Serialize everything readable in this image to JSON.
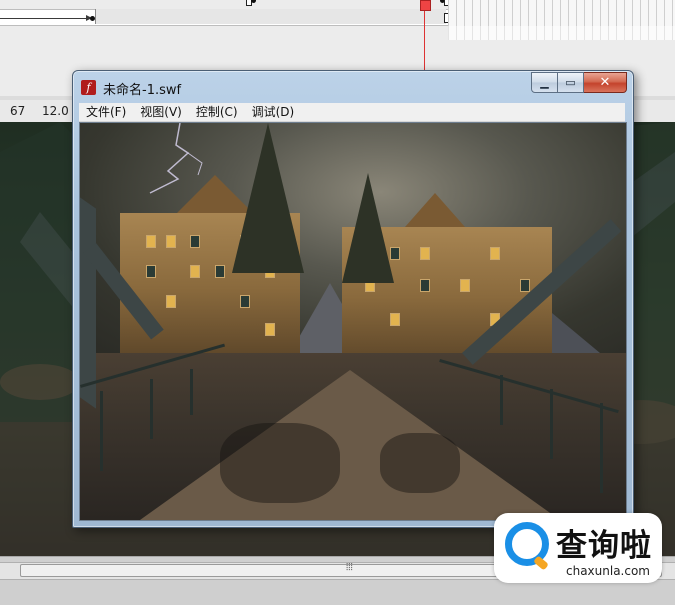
{
  "ide": {
    "status_frame": "67",
    "status_fps": "12.0"
  },
  "player_window": {
    "title": "未命名-1.swf",
    "app_icon_glyph": "f",
    "controls": {
      "minimize_glyph": "▁",
      "maximize_glyph": "▭",
      "close_glyph": "✕"
    },
    "menu": [
      {
        "label": "文件(F)"
      },
      {
        "label": "视图(V)"
      },
      {
        "label": "控制(C)"
      },
      {
        "label": "调试(D)"
      }
    ]
  },
  "scrollbar": {
    "grip_glyph": "⦙⦙⦙"
  },
  "watermark": {
    "title": "查询啦",
    "subtitle": "chaxunla.com",
    "accent_color": "#1a8fe6",
    "secondary_color": "#f5a623"
  }
}
